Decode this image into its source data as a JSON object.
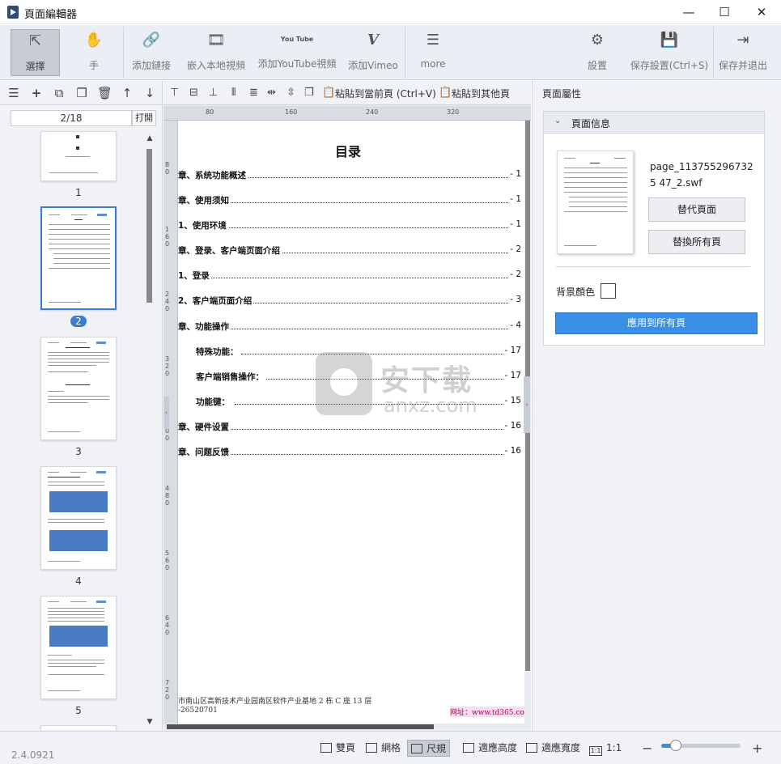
{
  "window": {
    "title": "頁面編輯器",
    "controls": {
      "minimize": "—",
      "maximize": "☐",
      "close": "✕"
    }
  },
  "toolbar": {
    "select_label": "選擇",
    "hand_label": "手",
    "add_link_label": "添加鏈接",
    "embed_video_label": "嵌入本地視頻",
    "youtube_label": "添加YouTube視頻",
    "vimeo_label": "添加Vimeo",
    "more_label": "more",
    "settings_label": "設置",
    "save_settings_label": "保存設置(Ctrl+S)",
    "save_exit_label": "保存并退出",
    "youtube_icon_text": "You Tube",
    "vimeo_icon_text": "V"
  },
  "left_panel": {
    "page_indicator": "2/18",
    "open_label": "打開",
    "thumbnails": [
      {
        "number": "1"
      },
      {
        "number": "2"
      },
      {
        "number": "3"
      },
      {
        "number": "4"
      },
      {
        "number": "5"
      }
    ],
    "selected_page": "2"
  },
  "center_toolbar": {
    "paste_current_label": "粘貼到當前頁 (Ctrl+V)",
    "paste_other_label": "粘貼到其他頁"
  },
  "ruler": {
    "h_ticks": [
      "80",
      "160",
      "240",
      "320"
    ],
    "v_ticks": [
      "80",
      "160",
      "240",
      "320",
      "400",
      "480",
      "560",
      "640",
      "720"
    ]
  },
  "document": {
    "title": "目录",
    "toc": [
      {
        "text": "章、系统功能概述",
        "page": "- 1"
      },
      {
        "text": "章、使用须知",
        "page": "- 1"
      },
      {
        "text": "1、使用环境",
        "page": "- 1"
      },
      {
        "text": "章、登录、客户端页面介绍",
        "page": "- 2"
      },
      {
        "text": "1、登录",
        "page": "- 2"
      },
      {
        "text": "2、客户端页面介绍",
        "page": "- 3"
      },
      {
        "text": "章、功能操作",
        "page": "- 4"
      },
      {
        "text": "特殊功能：",
        "page": "- 17"
      },
      {
        "text": "客户端销售操作：",
        "page": "- 17"
      },
      {
        "text": "功能键：",
        "page": "- 15"
      },
      {
        "text": "章、硬件设置",
        "page": "- 16"
      },
      {
        "text": "章、问题反馈",
        "page": "- 16"
      }
    ],
    "footer_address": "市南山区高新技术产业园南区软件产业基地 2 栋 C 座 13 层",
    "footer_phone": "-26520701",
    "footer_website": "网址：www.td365.com.cn"
  },
  "watermark": {
    "chinese": "安下载",
    "domain": "anxz.com"
  },
  "right_panel": {
    "title": "頁面屬性",
    "section_label": "頁面信息",
    "file_name": "page_1137552967325 47_2.swf",
    "replace_page_label": "替代頁面",
    "replace_all_label": "替換所有頁",
    "bg_color_label": "背景顏色",
    "bg_color": "#ffffff",
    "apply_all_label": "應用到所有頁"
  },
  "statusbar": {
    "version": "2.4.0921",
    "double_page_label": "雙頁",
    "grid_label": "網格",
    "ruler_label": "尺規",
    "fit_height_label": "適應高度",
    "fit_width_label": "適應寬度",
    "one_to_one_label": "1:1",
    "one_to_one_icon_text": "1:1",
    "zoom_minus": "−",
    "zoom_plus": "+",
    "zoom_level": 0.18
  },
  "colors": {
    "accent": "#3a8ee6",
    "selection": "#3a7bd5",
    "toolbar_bg": "#ebeef4"
  }
}
